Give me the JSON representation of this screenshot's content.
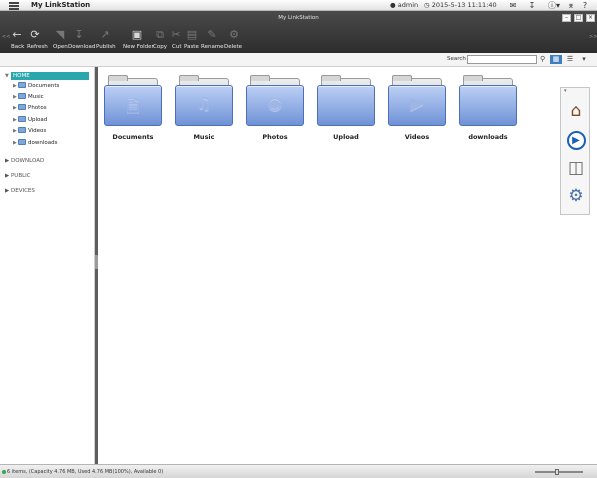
{
  "app": {
    "title": "My LinkStation",
    "user": "admin",
    "datetime": "2015-5-13 11:11:40",
    "help_label": "?"
  },
  "window": {
    "title": "My LinkStation"
  },
  "toolbar": {
    "buttons": [
      "Back",
      "Refresh",
      "Open",
      "Download",
      "Publish",
      "New Folder",
      "Copy",
      "Cut",
      "Paste",
      "Rename",
      "Delete"
    ],
    "collapse_left": "<<",
    "collapse_right": ">>"
  },
  "search": {
    "label": "Search",
    "value": ""
  },
  "tree": {
    "root": "HOME",
    "items": [
      "Documents",
      "Music",
      "Photos",
      "Upload",
      "Videos",
      "downloads"
    ],
    "sections": [
      "DOWNLOAD",
      "PUBLIC",
      "DEVICES"
    ]
  },
  "folders": [
    {
      "name": "Documents",
      "icon": "document-icon"
    },
    {
      "name": "Music",
      "icon": "music-note-icon"
    },
    {
      "name": "Photos",
      "icon": "camera-icon"
    },
    {
      "name": "Upload",
      "icon": "folder-icon"
    },
    {
      "name": "Videos",
      "icon": "video-camera-icon"
    },
    {
      "name": "downloads",
      "icon": "folder-icon"
    }
  ],
  "status": {
    "text": "6 items, (Capacity 4.76 MB, Used 4.76 MB(100%), Available 0)"
  },
  "colors": {
    "accent": "#2aa7ac",
    "folder": "#7fa0df",
    "toolbar": "#3a3a3a"
  }
}
